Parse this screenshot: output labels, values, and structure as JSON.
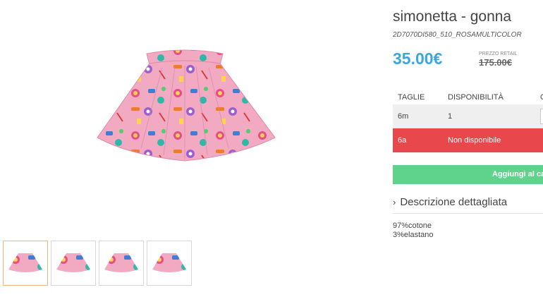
{
  "product": {
    "title": "simonetta - gonna",
    "sku": "2D7070DI580_510_ROSAMULTICOLOR",
    "price": "35.00€",
    "retail_label": "PREZZO RETAIL",
    "retail_price": "175.00€"
  },
  "sizes_table": {
    "headers": [
      "TAGLIE",
      "DISPONIBILITÀ",
      "Q"
    ],
    "rows": [
      {
        "size": "6m",
        "availability": "1",
        "status": "available"
      },
      {
        "size": "6a",
        "availability": "Non disponibile",
        "status": "unavailable"
      }
    ]
  },
  "cart": {
    "add_label": "Aggiungi al car"
  },
  "description": {
    "heading": "Descrizione dettagliata",
    "lines": [
      "97%cotone",
      "3%elastano"
    ]
  },
  "gallery": {
    "thumbnail_count": 4,
    "active_index": 0
  },
  "colors": {
    "price": "#3aa8dd",
    "unavailable_row": "#e8484b",
    "add_button": "#5fd38c",
    "active_thumb_border": "#f2b37a",
    "skirt_base": "#f2a9c2"
  },
  "icons": {
    "description_toggle": "chevron-right-icon"
  }
}
